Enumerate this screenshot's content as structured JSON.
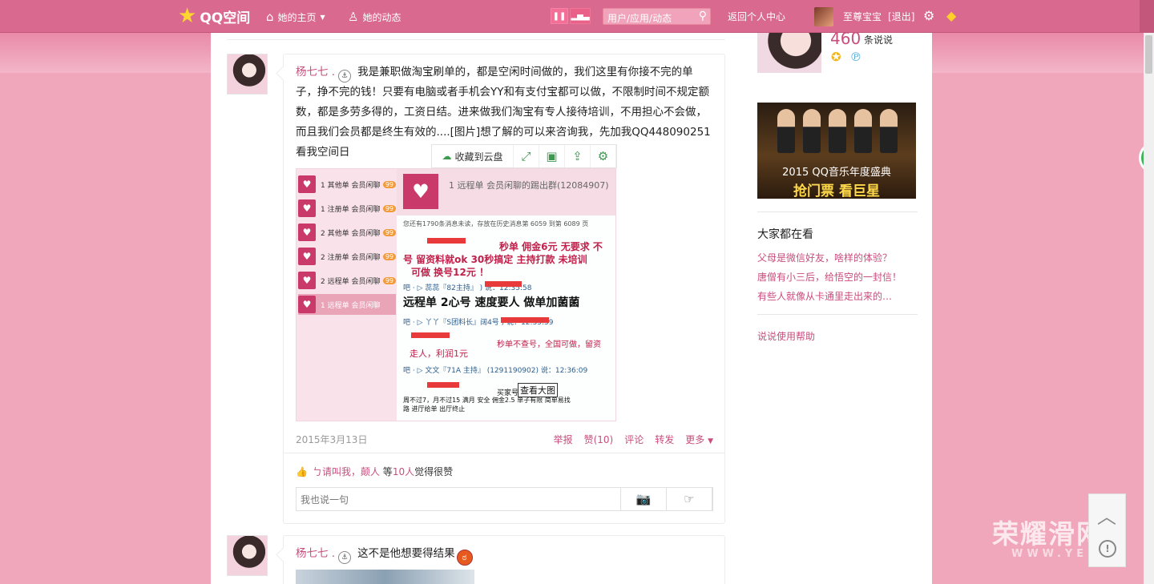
{
  "nav": {
    "logo_text": "QQ空间",
    "home_label": "她的主页",
    "dynamic_label": "她的动态",
    "search_placeholder": "用户/应用/动态",
    "personal_center": "返回个人中心",
    "username": "至尊宝宝",
    "logout": "[退出]"
  },
  "post1": {
    "author": "杨七七 .",
    "text": "我是兼职做淘宝刷单的，都是空闲时间做的，我们这里有你接不完的单子，挣不完的钱！只要有电脑或者手机会YY和有支付宝都可以做，不限制时间不规定额数，都是多劳多得的，工资日结。进来做我们淘宝有专人接待培训，不用担心不会做，而且我们会员都是终生有效的....[图片]想了解的可以来咨询我，先加我QQ448090251看我空间日",
    "toolbar_save": "收藏到云盘",
    "view_large": "查看大图",
    "date": "2015年3月13日",
    "actions": [
      "举报",
      "赞(10)",
      "评论",
      "转发",
      "更多"
    ],
    "likers": "ㄅ请叫我，颠人",
    "likes_mid": "等",
    "likes_count": "10人",
    "likes_suffix": "觉得很赞",
    "comment_placeholder": "我也说一句"
  },
  "screenshot": {
    "left_rows": [
      {
        "label": "1 其他单  会员闲聊",
        "count": "99"
      },
      {
        "label": "1 注册单  会员闲聊",
        "count": "99"
      },
      {
        "label": "2 其他单  会员闲聊",
        "count": "99"
      },
      {
        "label": "2 注册单  会员闲聊",
        "count": "99"
      },
      {
        "label": "2 远程单  会员闲聊",
        "count": "99"
      },
      {
        "label": "1 远程单  会员闲聊",
        "count": ""
      }
    ],
    "group_title": "1  远程单  会员闲聊的踢出群(12084907)",
    "history_note": "您还有1790条消息未读，存放在历史消息第 6059 到第 6089 页",
    "line1": "秒单  佣金6元  无要求  不",
    "line2": "号  留资料就ok  30秒搞定  主持打款  未培训",
    "line3": "可做  换号12元  ！",
    "meta1": "吧 · ▷ 蕊蕊『82主持』           ) 说：12:35:58",
    "line4": "远程单  2心号  速度要人    做单加菌菌",
    "meta2": "吧 · ▷ 丫丫『S团料长』阔4号               ) 说：12:35:59",
    "line5": "秒单不查号，全国可做，留资",
    "line6": "走人，利润1元",
    "meta3": "吧 · ▷ 文文『71A 主持』 (1291190902) 说：12:36:09",
    "line7": "买家号          收不过    4",
    "line8": "周不过7，月不过15 满月  安全    佣金2.5   单子有限    简单易找",
    "line9": "路  进厅给单    出厅终止"
  },
  "post2": {
    "author": "杨七七 .",
    "text": "这不是他想要得结果"
  },
  "sidebar": {
    "count": "460",
    "count_label": "条说说",
    "banner_line1": "2015 QQ音乐年度盛典",
    "banner_line2": "抢门票  看巨星",
    "section_title": "大家都在看",
    "links": [
      "父母是微信好友，啥样的体验？",
      "唐僧有小三后，给悟空的一封信！",
      "有些人就像从卡通里走出来的…"
    ],
    "help": "说说使用帮助"
  },
  "floaters": {
    "badge": "41",
    "watermark": "荣耀滑网",
    "watermark_sub": "WWW.YE    .CN"
  }
}
